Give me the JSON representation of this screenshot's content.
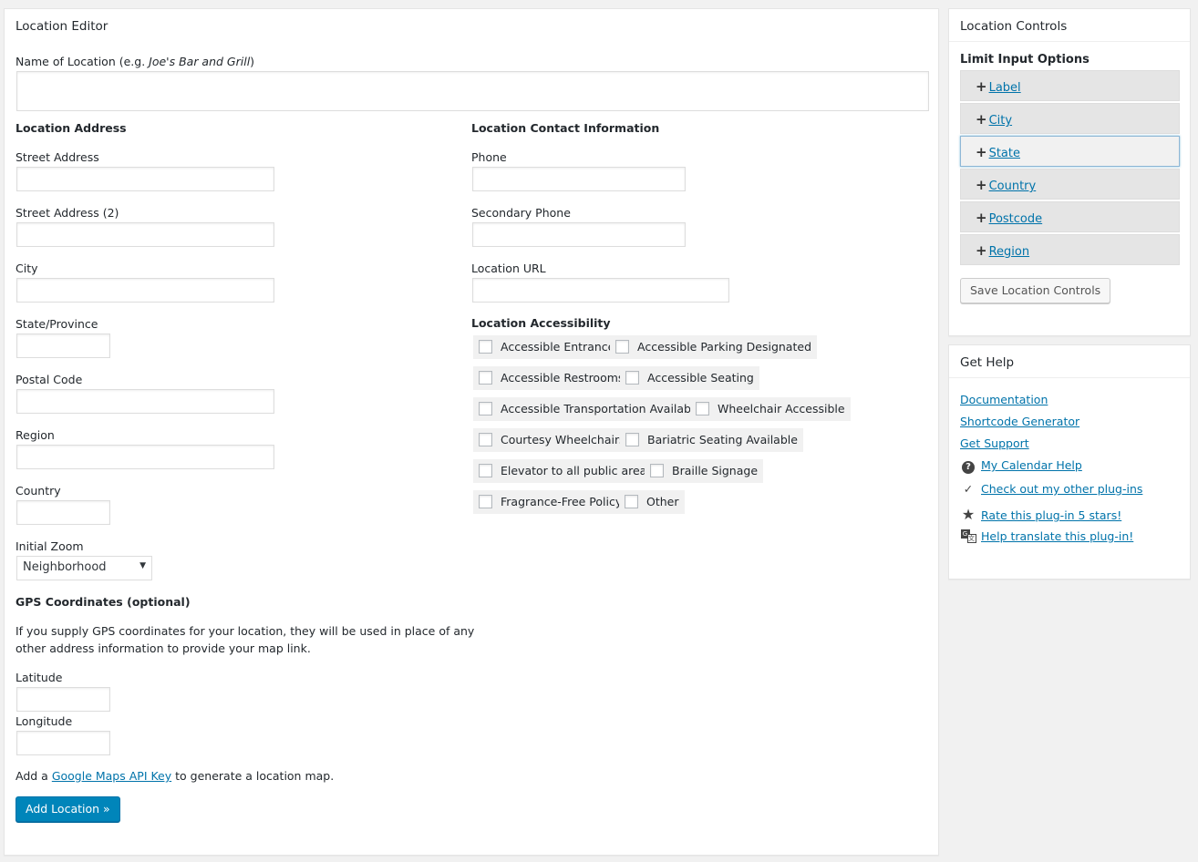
{
  "editor": {
    "title": "Location Editor",
    "name_label_prefix": "Name of Location (e.g. ",
    "name_label_example": "Joe's Bar and Grill",
    "name_label_suffix": ")",
    "name_value": "",
    "address": {
      "heading": "Location Address",
      "street_label": "Street Address",
      "street2_label": "Street Address (2)",
      "city_label": "City",
      "state_label": "State/Province",
      "postal_label": "Postal Code",
      "region_label": "Region",
      "country_label": "Country",
      "zoom_label": "Initial Zoom",
      "zoom_value": "Neighborhood"
    },
    "gps": {
      "heading": "GPS Coordinates (optional)",
      "description_line1": "If you supply GPS coordinates for your location, they will be used in place of any",
      "description_line2": "other address information to provide your map link.",
      "latitude_label": "Latitude",
      "longitude_label": "Longitude"
    },
    "maps_note_prefix": "Add a ",
    "maps_note_link": "Google Maps API Key",
    "maps_note_suffix": " to generate a location map.",
    "submit_label": "Add Location »",
    "contact": {
      "heading": "Location Contact Information",
      "phone_label": "Phone",
      "phone2_label": "Secondary Phone",
      "url_label": "Location URL"
    },
    "accessibility": {
      "heading": "Location Accessibility",
      "options": [
        "Accessible Entrance",
        "Accessible Parking Designated",
        "Accessible Restrooms",
        "Accessible Seating",
        "Accessible Transportation Available",
        "Wheelchair Accessible",
        "Courtesy Wheelchairs",
        "Bariatric Seating Available",
        "Elevator to all public areas",
        "Braille Signage",
        "Fragrance-Free Policy",
        "Other"
      ]
    }
  },
  "controls": {
    "title": "Location Controls",
    "subheading": "Limit Input Options",
    "items": [
      "Label",
      "City",
      "State",
      "Country",
      "Postcode",
      "Region"
    ],
    "active_item": "State",
    "save_label": "Save Location Controls"
  },
  "help": {
    "title": "Get Help",
    "links": [
      "Documentation",
      "Shortcode Generator",
      "Get Support"
    ],
    "icon_links": [
      {
        "icon": "question-icon",
        "label": "My Calendar Help"
      },
      {
        "icon": "check-icon",
        "label": "Check out my other plug-ins"
      },
      {
        "icon": "star-icon",
        "label": "Rate this plug-in 5 stars!"
      },
      {
        "icon": "translate-icon",
        "label": "Help translate this plug-in!"
      }
    ]
  },
  "colors": {
    "primary_button": "#0085ba",
    "link": "#0073aa",
    "background": "#f1f1f1"
  }
}
